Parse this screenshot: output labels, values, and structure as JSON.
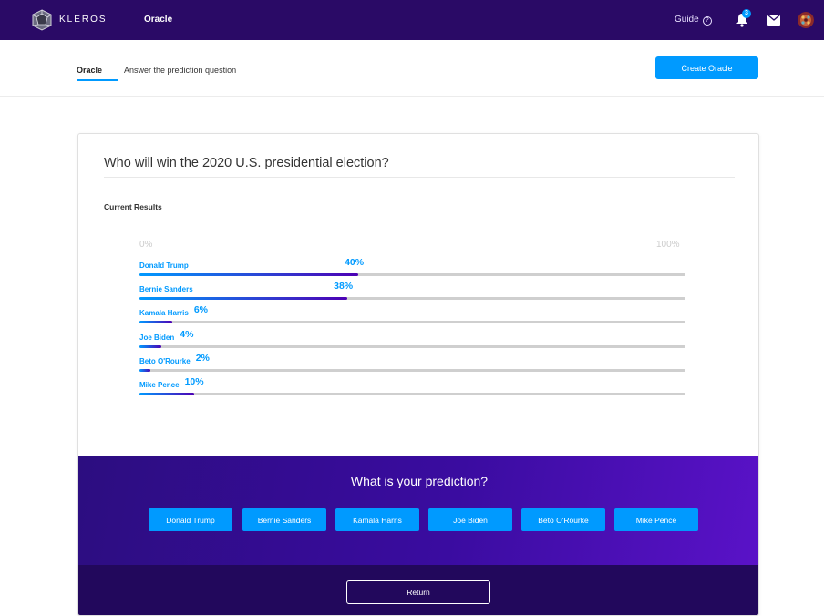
{
  "header": {
    "logo_text": "KLEROS",
    "nav_title": "Oracle",
    "guide_label": "Guide",
    "notification_count": "3",
    "colors": {
      "bar": "#2a0a66",
      "accent": "#009aff"
    }
  },
  "subnav": {
    "tab_label": "Oracle",
    "subtitle": "Answer the prediction question",
    "create_button": "Create Oracle"
  },
  "question": {
    "title": "Who will win the 2020 U.S. presidential election?",
    "results_label": "Current Results",
    "axis_min": "0%",
    "axis_max": "100%",
    "results": [
      {
        "name": "Donald Trump",
        "percent_label": "40%",
        "value": 40
      },
      {
        "name": "Bernie Sanders",
        "percent_label": "38%",
        "value": 38
      },
      {
        "name": "Kamala Harris",
        "percent_label": "6%",
        "value": 6
      },
      {
        "name": "Joe Biden",
        "percent_label": "4%",
        "value": 4
      },
      {
        "name": "Beto O'Rourke",
        "percent_label": "2%",
        "value": 2
      },
      {
        "name": "Mike Pence",
        "percent_label": "10%",
        "value": 10
      }
    ]
  },
  "prediction": {
    "title": "What is your prediction?",
    "options": [
      "Donald Trump",
      "Bernie Sanders",
      "Kamala Harris",
      "Joe Biden",
      "Beto O'Rourke",
      "Mike Pence"
    ],
    "return_label": "Return"
  },
  "icons": [
    "kleros-logo-icon",
    "help-circle-icon",
    "bell-icon",
    "mail-icon",
    "avatar-icon"
  ]
}
